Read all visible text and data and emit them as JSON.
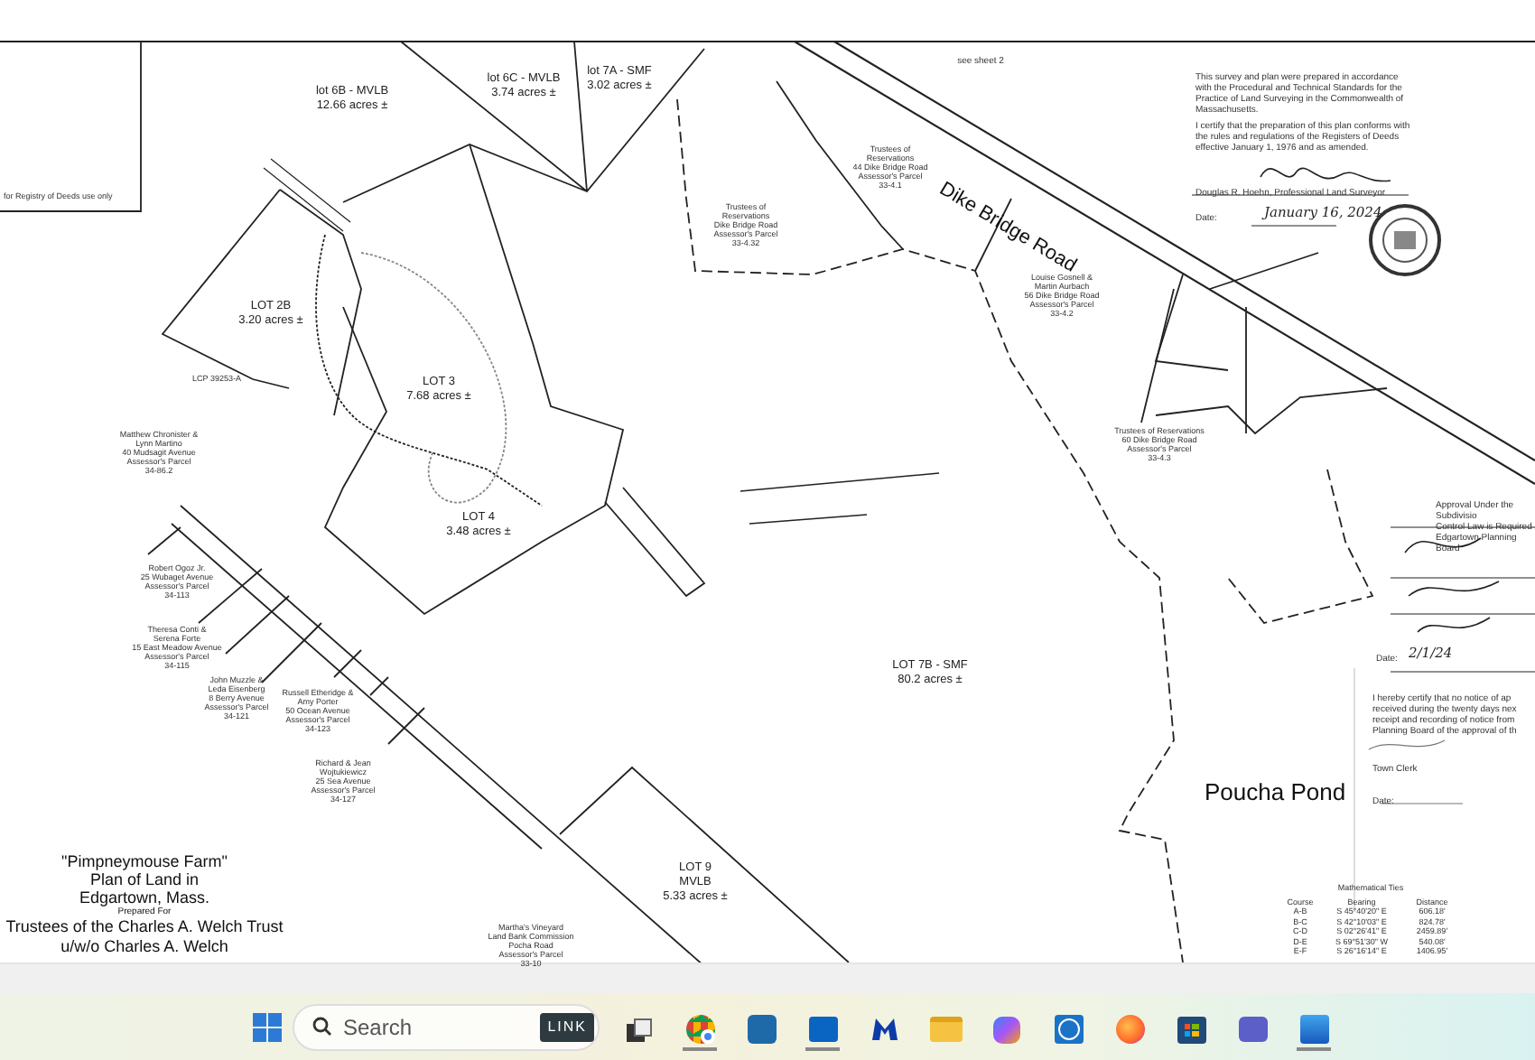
{
  "plan": {
    "labels": [
      {
        "kind": "registry",
        "text": "for Registry of Deeds use only"
      },
      {
        "kind": "lot",
        "text": "lot 6B - MVLB\n12.66 acres ±"
      },
      {
        "kind": "lot",
        "text": "lot 6C - MVLB\n3.74 acres ±"
      },
      {
        "kind": "lot",
        "text": "lot 7A - SMF\n3.02 acres ±"
      },
      {
        "kind": "note",
        "text": "see sheet 2"
      },
      {
        "kind": "cert",
        "text": "This survey and plan were prepared in accordance with the Procedural and Technical Standards for the Practice of Land Surveying in the Commonwealth of Massachusetts."
      },
      {
        "kind": "cert",
        "text": "I certify that the preparation of this plan conforms with the rules and regulations of the Registers of Deeds effective January 1, 1976 and as amended."
      },
      {
        "kind": "cert",
        "text": "Douglas R. Hoehn, Professional Land Surveyor"
      },
      {
        "kind": "cert",
        "text": "Date:"
      },
      {
        "kind": "script",
        "text": "January 16, 2024"
      },
      {
        "kind": "road",
        "text": "Dike Bridge Road"
      },
      {
        "kind": "parcel",
        "text": "Trustees of\nReservations\n44 Dike Bridge Road\nAssessor's Parcel\n33-4.1"
      },
      {
        "kind": "parcel",
        "text": "Trustees of\nReservations\nDike Bridge Road\nAssessor's Parcel\n33-4.32"
      },
      {
        "kind": "parcel",
        "text": "Louise Gosnell &\nMartin Aurbach\n56 Dike Bridge Road\nAssessor's Parcel\n33-4.2"
      },
      {
        "kind": "parcel",
        "text": "Trustees of Reservations\n60 Dike Bridge Road\nAssessor's Parcel\n33-4.3"
      },
      {
        "kind": "lot",
        "text": "LOT 2B\n3.20 acres ±"
      },
      {
        "kind": "parcel",
        "text": "LCP 39253-A"
      },
      {
        "kind": "lot",
        "text": "LOT 3\n7.68 acres ±"
      },
      {
        "kind": "parcel",
        "text": "Matthew Chronister &\nLynn Martino\n40 Mudsagit Avenue\nAssessor's Parcel\n34-86.2"
      },
      {
        "kind": "lot",
        "text": "LOT 4\n3.48 acres ±"
      },
      {
        "kind": "parcel",
        "text": "Robert Ogoz Jr.\n25 Wubaget Avenue\nAssessor's Parcel\n34-113"
      },
      {
        "kind": "parcel",
        "text": "Theresa Conti &\nSerena Forte\n15 East Meadow Avenue\nAssessor's Parcel\n34-115"
      },
      {
        "kind": "parcel",
        "text": "John Muzzle &\nLeda Eisenberg\n8 Berry Avenue\nAssessor's Parcel\n34-121"
      },
      {
        "kind": "parcel",
        "text": "Russell Etheridge &\nAmy Porter\n50 Ocean Avenue\nAssessor's Parcel\n34-123"
      },
      {
        "kind": "parcel",
        "text": "Richard & Jean\nWojtukiewicz\n25 Sea Avenue\nAssessor's Parcel\n34-127"
      },
      {
        "kind": "lot",
        "text": "LOT 7B - SMF\n80.2 acres ±"
      },
      {
        "kind": "pond",
        "text": "Poucha Pond"
      },
      {
        "kind": "cert",
        "text": "Approval Under the Subdivisio\nControl Law is Required\nEdgartown Planning Board"
      },
      {
        "kind": "cert",
        "text": "Date:"
      },
      {
        "kind": "script",
        "text": "2/1/24"
      },
      {
        "kind": "cert",
        "text": "I hereby certify that no notice of ap\nreceived during the twenty days nex\nreceipt and recording of notice from\nPlanning Board of the approval of th"
      },
      {
        "kind": "cert",
        "text": "Town Clerk"
      },
      {
        "kind": "cert",
        "text": "Date:"
      },
      {
        "kind": "lot",
        "text": "LOT 9\nMVLB\n5.33 acres ±"
      },
      {
        "kind": "parcel",
        "text": "Martha's Vineyard\nLand Bank Commission\nPocha Road\nAssessor's Parcel\n33-10"
      }
    ],
    "title_block": [
      "\"Pimpneymouse Farm\"",
      "Plan of Land in",
      "Edgartown, Mass.",
      "Prepared For",
      "Trustees of the Charles A. Welch Trust",
      "u/w/o Charles A. Welch"
    ],
    "ties": {
      "title": "Mathematical Ties",
      "columns": [
        "Course",
        "Bearing",
        "Distance"
      ],
      "rows": [
        [
          "A-B",
          "S 45°40'20\" E",
          "606.18'"
        ],
        [
          "B-C",
          "S 42°10'03\" E",
          "824.78'"
        ],
        [
          "C-D",
          "S 02°26'41\" E",
          "2459.89'"
        ],
        [
          "D-E",
          "S 69°51'30\" W",
          "540.08'"
        ],
        [
          "E-F",
          "S 26°16'14\" E",
          "1406.95'"
        ]
      ]
    }
  },
  "taskbar": {
    "search": {
      "placeholder": "Search"
    },
    "badge": "LINK",
    "apps": [
      {
        "kind": "taskview",
        "running": false
      },
      {
        "kind": "chrome",
        "running": true
      },
      {
        "kind": "sapp",
        "running": false
      },
      {
        "kind": "outlook",
        "running": true
      },
      {
        "kind": "malware",
        "running": false
      },
      {
        "kind": "folder",
        "running": false
      },
      {
        "kind": "copilot",
        "running": false
      },
      {
        "kind": "dell",
        "running": false
      },
      {
        "kind": "firefox",
        "running": false
      },
      {
        "kind": "store",
        "running": false
      },
      {
        "kind": "teams",
        "running": false
      },
      {
        "kind": "word",
        "running": true
      }
    ]
  }
}
